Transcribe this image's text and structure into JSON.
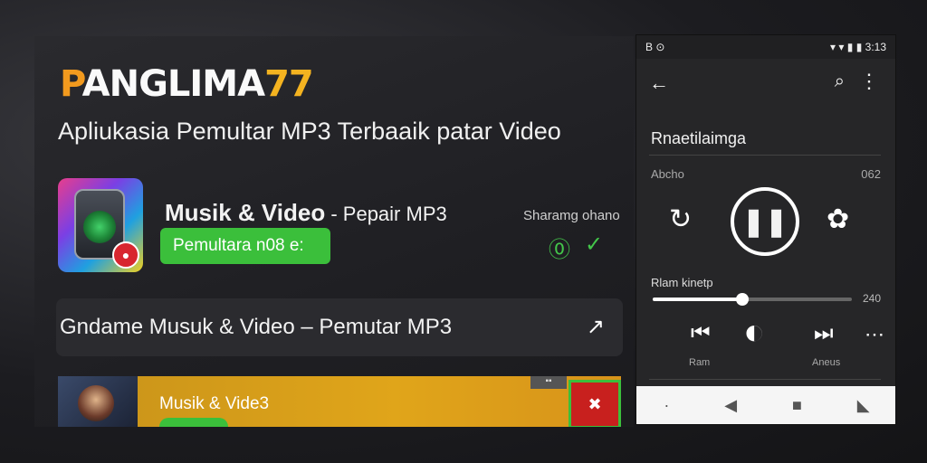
{
  "brand": {
    "part1": "P",
    "part2": "ANGLIMA",
    "part3": "77"
  },
  "subtitle": "Apliukasia Pemultar MP3 Terbaaik patar Video",
  "app": {
    "title_bold": "Musik & Video",
    "title_light": " - Pepair MP3",
    "action_label": "Pemultara n08 e:",
    "share_label": "Sharamg ohano"
  },
  "link_row": {
    "text": "Gndame Musuk & Video – Pemutar MP3"
  },
  "card": {
    "title": "Musik & Vide3"
  },
  "phone": {
    "status_time": "3:13",
    "status_left": "B",
    "track_title": "Rnaetilaimga",
    "meta_left": "Abcho",
    "meta_right": "062",
    "seek_label": "Rlam kinetp",
    "seek_end": "240",
    "progress": 0.45,
    "prev_label": "Ram",
    "next_label": "Aneus"
  }
}
